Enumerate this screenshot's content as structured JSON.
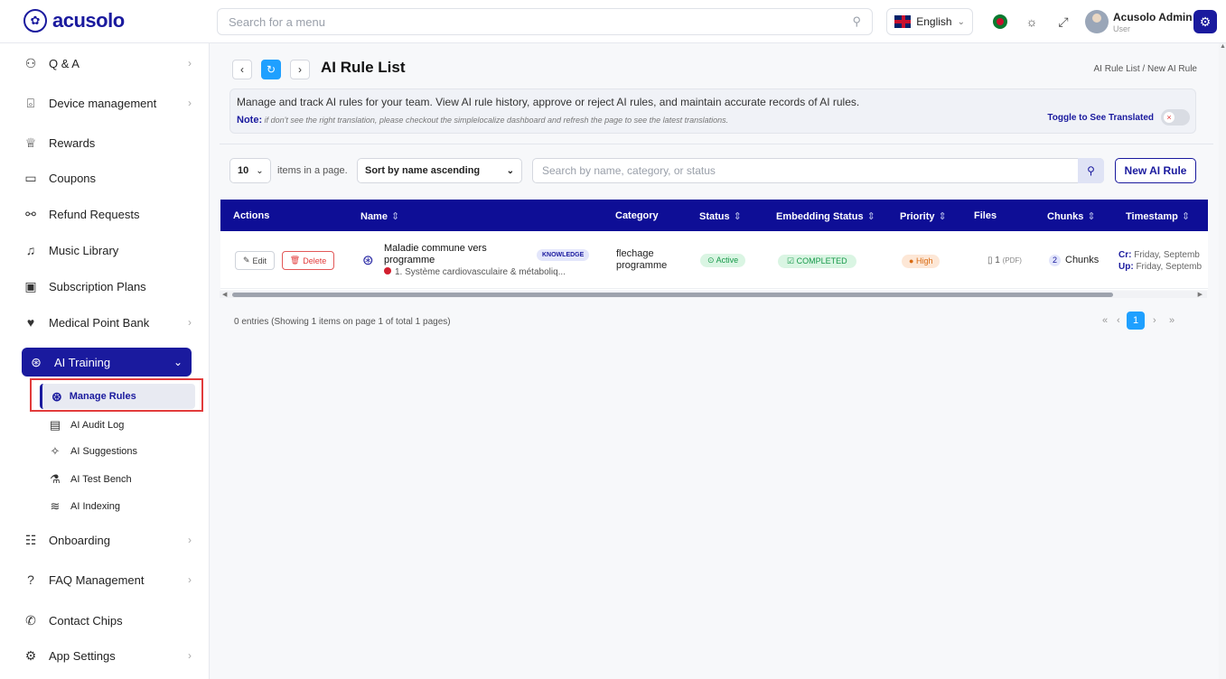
{
  "brand": {
    "name": "acusolo"
  },
  "topbar": {
    "search_placeholder": "Search for a menu",
    "language": "English",
    "user_name": "Acusolo Admin",
    "user_role": "User"
  },
  "sidebar": {
    "items": [
      {
        "label": "Q & A",
        "icon": "qa-icon"
      },
      {
        "label": "Device management",
        "icon": "device-icon"
      },
      {
        "label": "Rewards",
        "icon": "trophy-icon"
      },
      {
        "label": "Coupons",
        "icon": "coupon-icon"
      },
      {
        "label": "Refund Requests",
        "icon": "refund-icon"
      },
      {
        "label": "Music Library",
        "icon": "music-icon"
      },
      {
        "label": "Subscription Plans",
        "icon": "subscription-icon"
      },
      {
        "label": "Medical Point Bank",
        "icon": "medical-icon"
      },
      {
        "label": "AI Training",
        "icon": "brain-icon"
      },
      {
        "label": "Onboarding",
        "icon": "sliders-icon"
      },
      {
        "label": "FAQ Management",
        "icon": "help-icon"
      },
      {
        "label": "Contact Chips",
        "icon": "phone-icon"
      },
      {
        "label": "App Settings",
        "icon": "settings-icon"
      }
    ],
    "sub_items": [
      {
        "label": "Manage Rules",
        "icon": "brain-icon"
      },
      {
        "label": "AI Audit Log",
        "icon": "log-icon"
      },
      {
        "label": "AI Suggestions",
        "icon": "sparkle-icon"
      },
      {
        "label": "AI Test Bench",
        "icon": "flask-icon"
      },
      {
        "label": "AI Indexing",
        "icon": "layers-icon"
      }
    ]
  },
  "page": {
    "title": "AI Rule List",
    "breadcrumb": "AI Rule List / New AI Rule",
    "info_text": "Manage and track AI rules for your team. View AI rule history, approve or reject AI rules, and maintain accurate records of AI rules.",
    "note_label": "Note:",
    "note_text": "if don't see the right translation, please checkout the simplelocalize dashboard and refresh the page to see the latest translations.",
    "toggle_label": "Toggle to See Translated"
  },
  "toolbar": {
    "page_size": "10",
    "items_label": "items in a page.",
    "sort_value": "Sort by name ascending",
    "search_placeholder": "Search by name, category, or status",
    "new_button": "New AI Rule"
  },
  "table": {
    "headers": [
      "Actions",
      "Name",
      "Category",
      "Status",
      "Embedding Status",
      "Priority",
      "Files",
      "Chunks",
      "Timestamp"
    ],
    "rows": [
      {
        "edit": "Edit",
        "delete": "Delete",
        "name": "Maladie commune vers programme",
        "tag": "KNOWLEDGE",
        "sub": "1. Système cardiovasculaire & métaboliq...",
        "category": "flechage programme",
        "status": "Active",
        "embedding": "COMPLETED",
        "priority": "High",
        "files_count": "1",
        "files_type": "(PDF)",
        "chunks_count": "2",
        "chunks_label": "Chunks",
        "created_label": "Cr:",
        "created": "Friday, Septemb",
        "updated_label": "Up:",
        "updated": "Friday, Septemb"
      }
    ]
  },
  "footer": {
    "entries": "0 entries (Showing 1 items on page 1 of total 1 pages)",
    "current_page": "1"
  }
}
